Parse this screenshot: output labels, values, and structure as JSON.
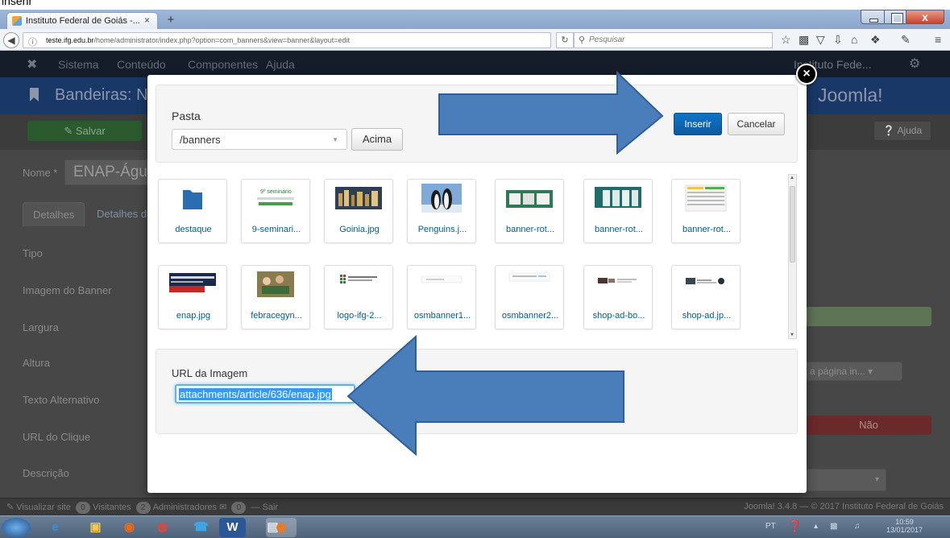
{
  "caption": "inserir",
  "browser": {
    "tab_title": "Instituto Federal de Goiás -...",
    "tab_close": "×",
    "new_tab": "+",
    "url_host": "teste.ifg.edu.br",
    "url_path": "/home/administrator/index.php?option=com_banners&view=banner&layout=edit",
    "search_placeholder": "Pesquisar"
  },
  "joomla": {
    "menu": [
      "Sistema",
      "Conteúdo",
      "Componentes",
      "Ajuda"
    ],
    "site_name": "Instituto Fede...",
    "page_title": "Bandeiras: N",
    "brand": "Joomla!",
    "save_label": "Salvar",
    "help_label": "Ajuda",
    "name_label": "Nome *",
    "name_value": "ENAP-Águl",
    "tabs": [
      "Detalhes",
      "Detalhes d"
    ],
    "fields": [
      "Tipo",
      "Imagem do Banner",
      "Largura",
      "Altura",
      "Texto Alternativo",
      "URL do Clique",
      "Descrição"
    ],
    "target_select": "a página in...",
    "no_label": "Não",
    "status_left": [
      "Visualizar site",
      "0",
      "Visitantes",
      "2",
      "Administradores",
      "0",
      "Sair"
    ],
    "status_right": "Joomla! 3.4.8 — © 2017 Instituto Federal de Goiás"
  },
  "modal": {
    "folder_label": "Pasta",
    "folder_value": "/banners",
    "up_button": "Acima",
    "insert_button": "Inserir",
    "cancel_button": "Cancelar",
    "close_symbol": "×",
    "items": [
      {
        "label": "destaque"
      },
      {
        "label": "9-seminari..."
      },
      {
        "label": "Goinia.jpg"
      },
      {
        "label": "Penguins.j..."
      },
      {
        "label": "banner-rot..."
      },
      {
        "label": "banner-rot..."
      },
      {
        "label": "banner-rot..."
      },
      {
        "label": "enap.jpg"
      },
      {
        "label": "febracegyn..."
      },
      {
        "label": "logo-ifg-2..."
      },
      {
        "label": "osmbanner1..."
      },
      {
        "label": "osmbanner2..."
      },
      {
        "label": "shop-ad-bo..."
      },
      {
        "label": "shop-ad.jp..."
      }
    ],
    "url_label": "URL da Imagem",
    "url_value": "attachments/article/636/enap.jpg"
  },
  "taskbar": {
    "lang": "PT",
    "time": "10:59",
    "date": "13/01/2017"
  },
  "colors": {
    "primary": "#0b5a9f",
    "arrow_fill": "#4a7ebb",
    "link": "#005e8d"
  }
}
